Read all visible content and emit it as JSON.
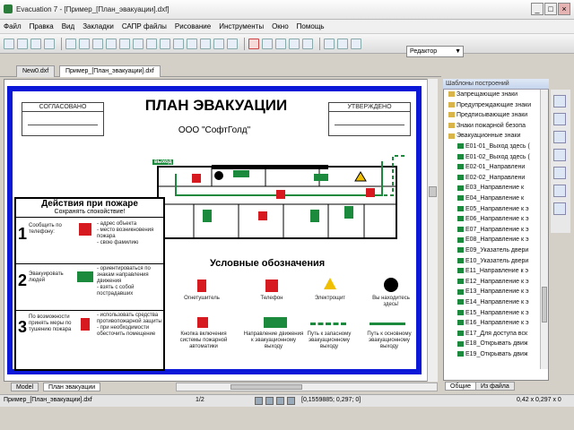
{
  "window": {
    "title": "Evacuation 7 - [Пример_[План_эвакуации].dxf]"
  },
  "menu": [
    "Файл",
    "Правка",
    "Вид",
    "Закладки",
    "САПР файлы",
    "Рисование",
    "Инструменты",
    "Окно",
    "Помощь"
  ],
  "toolbar": {
    "layout_combo": "Редактор"
  },
  "tabs": [
    "New0.dxf",
    "Пример_[План_эвакуации].dxf"
  ],
  "layout_tabs": [
    "Model",
    "План эвакуации"
  ],
  "plan": {
    "left_stamp": "СОГЛАСОВАНО",
    "right_stamp": "УТВЕРЖДЕНО",
    "title": "ПЛАН ЭВАКУАЦИИ",
    "company": "ООО \"СофтГолд\"",
    "exit_label": "выход",
    "actions_title": "Действия при пожаре",
    "actions_subtitle": "Сохранять спокойствие!",
    "step1": "Сообщить по телефону:",
    "step1_items": "- адрес объекта\n- место возникновения пожара\n- свою фамилию",
    "step2": "Эвакуировать людей",
    "step2_items": "- ориентироваться по знакам направления движения\n- взять с собой пострадавших",
    "step3": "По возможности принять меры по тушению пожара",
    "step3_items": "- использовать средства противопожарной защиты\n- при необходимости обесточить помещение",
    "legend_title": "Условные обозначения",
    "legend_1": "Огнетушитель",
    "legend_2": "Телефон",
    "legend_3": "Электрощит",
    "legend_4": "Вы находитесь здесь!",
    "legend_5": "Кнопка включения системы пожарной автоматики",
    "legend_6": "Направление движения к эвакуационному выходу",
    "legend_7": "Путь к запасному эвакуационному выходу",
    "legend_8": "Путь к основному эвакуационному выходу"
  },
  "panel": {
    "title": "Шаблоны построений",
    "items": [
      "Запрещающие знаки",
      "Предупреждающие знаки",
      "Предписывающие знаки",
      "Знаки пожарной безопа",
      "Эвакуационные знаки",
      "E01-01_Выход здесь (",
      "E01-02_Выход здесь (",
      "E02-01_Направлени",
      "E02-02_Направлени",
      "E03_Направление к",
      "E04_Направление к",
      "E05_Направление к э",
      "E06_Направление к э",
      "E07_Направление к э",
      "E08_Направление к э",
      "E09_Указатель двери",
      "E10_Указатель двери",
      "E11_Направление к э",
      "E12_Направление к э",
      "E13_Направление к э",
      "E14_Направление к э",
      "E15_Направление к э",
      "E16_Направление к э",
      "E17_Для доступа вск",
      "E18_Открывать движ",
      "E19_Открывать движ"
    ],
    "tabs": [
      "Общие",
      "Из файла"
    ]
  },
  "status": {
    "file": "Пример_[План_эвакуации].dxf",
    "page": "1/2",
    "coords": "[0,1559885; 0,297; 0]",
    "size": "0,42 x 0,297 x 0"
  },
  "colors": {
    "frame_blue": "#0b18d8",
    "exit_green": "#1c8a3c",
    "fire_red": "#d71920"
  }
}
